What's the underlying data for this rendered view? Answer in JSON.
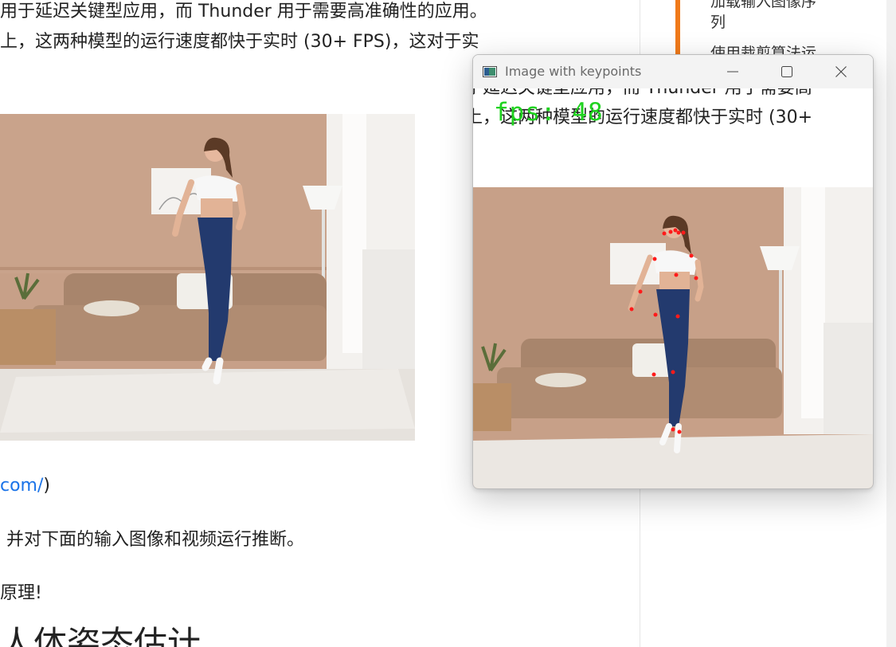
{
  "article": {
    "line1": "用于延迟关键型应用，而 Thunder 用于需要高准确性的应用。",
    "line2": "上，这两种模型的运行速度都快于实时 (30+ FPS)，这对于实",
    "link_text": "com/",
    "link_suffix": ")",
    "line3": "并对下面的输入图像和视频运行推断。",
    "line4": "原理!",
    "heading": "人体姿态估计"
  },
  "sidebar": {
    "items": [
      {
        "label": "加载输入图像序"
      },
      {
        "label": "列"
      },
      {
        "label": "使用裁剪算法运"
      }
    ],
    "accent": "#f07a1a"
  },
  "window": {
    "title": "Image with keypoints",
    "app_icon": "image-app-icon",
    "controls": [
      "minimize-icon",
      "maximize-icon",
      "close-icon"
    ],
    "mirror_line1": "于延迟关键型应用，而 Thunder 用于需要高",
    "mirror_line2": "上，这两种模型的运行速度都快于实时 (30+",
    "fps_text": "fps: 48",
    "fps_color": "#1fd31f",
    "keypoint_color": "#ff1a1a"
  }
}
